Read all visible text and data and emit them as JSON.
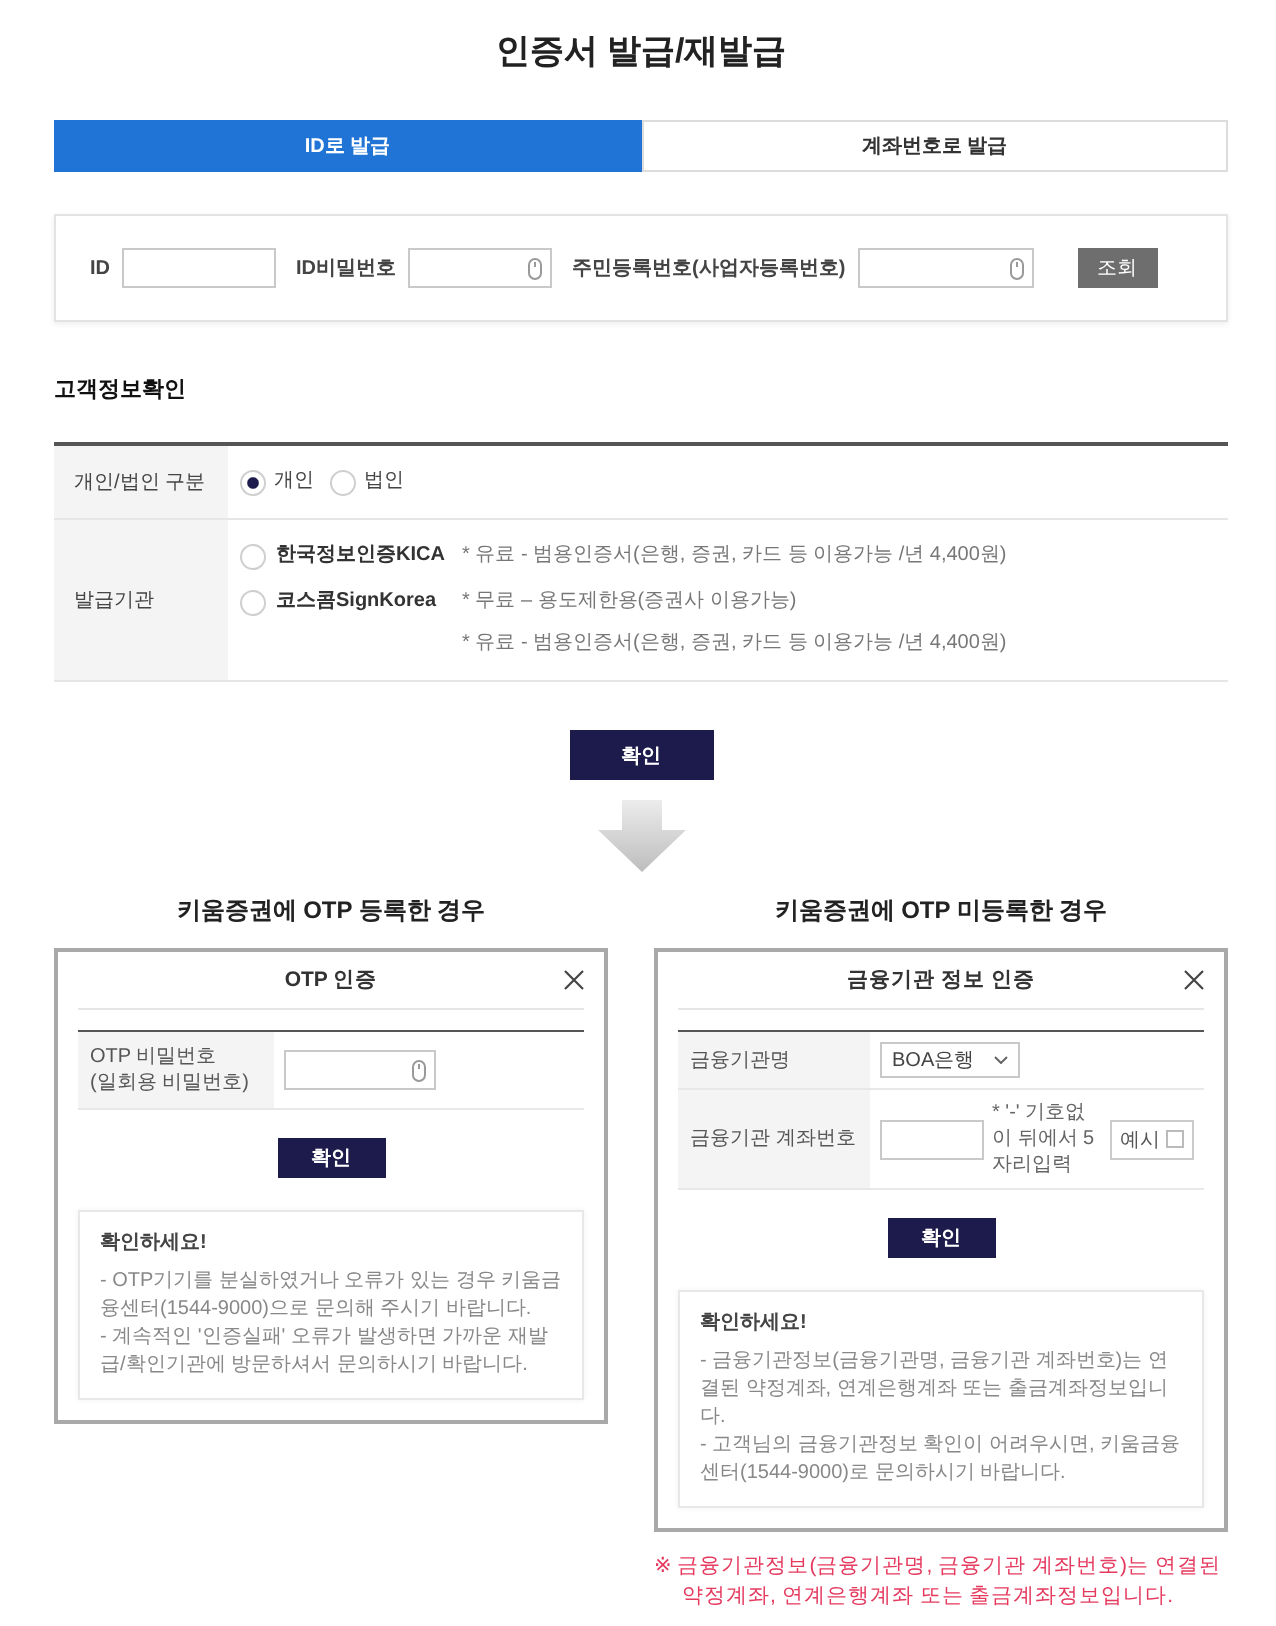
{
  "title": "인증서 발급/재발급",
  "tabs": [
    {
      "label": "ID로 발급",
      "selected": true
    },
    {
      "label": "계좌번호로 발급",
      "selected": false
    }
  ],
  "id_form": {
    "fields": [
      {
        "label": "ID",
        "kind": "text"
      },
      {
        "label": "ID비밀번호",
        "kind": "secure"
      },
      {
        "label": "주민등록번호(사업자등록번호)",
        "kind": "secure"
      }
    ],
    "button": "조회"
  },
  "customer_info": {
    "heading": "고객정보확인",
    "rows": [
      {
        "label": "개인/법인 구분",
        "kind": "inline",
        "options": [
          {
            "label": "개인",
            "selected": true
          },
          {
            "label": "법인",
            "selected": false
          }
        ]
      },
      {
        "label": "발급기관",
        "kind": "stacked",
        "options": [
          {
            "label": "한국정보인증KICA",
            "selected": false,
            "notes": [
              "* 유료 - 범용인증서(은행, 증권, 카드 등 이용가능 /년 4,400원)"
            ]
          },
          {
            "label": "코스콤SignKorea",
            "selected": false,
            "notes": [
              "* 무료 – 용도제한용(증권사 이용가능)",
              "* 유료 - 범용인증서(은행, 증권, 카드 등 이용가능 /년 4,400원)"
            ]
          }
        ]
      }
    ]
  },
  "confirm_button": "확인",
  "cases": [
    {
      "heading": "키움증권에 OTP 등록한 경우",
      "dialog": {
        "title": "OTP 인증",
        "rows": [
          {
            "label_lines": [
              "OTP 비밀번호",
              "(일회용 비밀번호)"
            ],
            "kind": "secure"
          }
        ],
        "button": "확인",
        "notice": {
          "title": "확인하세요!",
          "items": [
            "- OTP기기를 분실하였거나 오류가 있는 경우 키움금융센터(1544-9000)으로 문의해 주시기 바랍니다.",
            "- 계속적인 '인증실패' 오류가 발생하면 가까운 재발급/확인기관에 방문하셔서 문의하시기 바랍니다."
          ]
        }
      }
    },
    {
      "heading": "키움증권에 OTP 미등록한 경우",
      "dialog": {
        "title": "금융기관 정보 인증",
        "rows": [
          {
            "label_lines": [
              "금융기관명"
            ],
            "kind": "select",
            "value": "BOA은행"
          },
          {
            "label_lines": [
              "금융기관 계좌번호"
            ],
            "kind": "account",
            "hint": "* '-' 기호없이 뒤에서 5자리입력",
            "example": {
              "label": "예시",
              "checked": false
            }
          }
        ],
        "button": "확인",
        "notice": {
          "title": "확인하세요!",
          "items": [
            "- 금융기관정보(금융기관명, 금융기관 계좌번호)는 연결된 약정계좌, 연계은행계좌 또는 출금계좌정보입니다.",
            "- 고객님의 금융기관정보 확인이 어려우시면, 키움금융센터(1544-9000)로 문의하시기 바랍니다."
          ]
        }
      }
    }
  ],
  "footnote": {
    "lines": [
      "※ 금융기관정보(금융기관명, 금융기관 계좌번호)는 연결된",
      "약정계좌, 연계은행계좌 또는 출금계좌정보입니다."
    ]
  }
}
